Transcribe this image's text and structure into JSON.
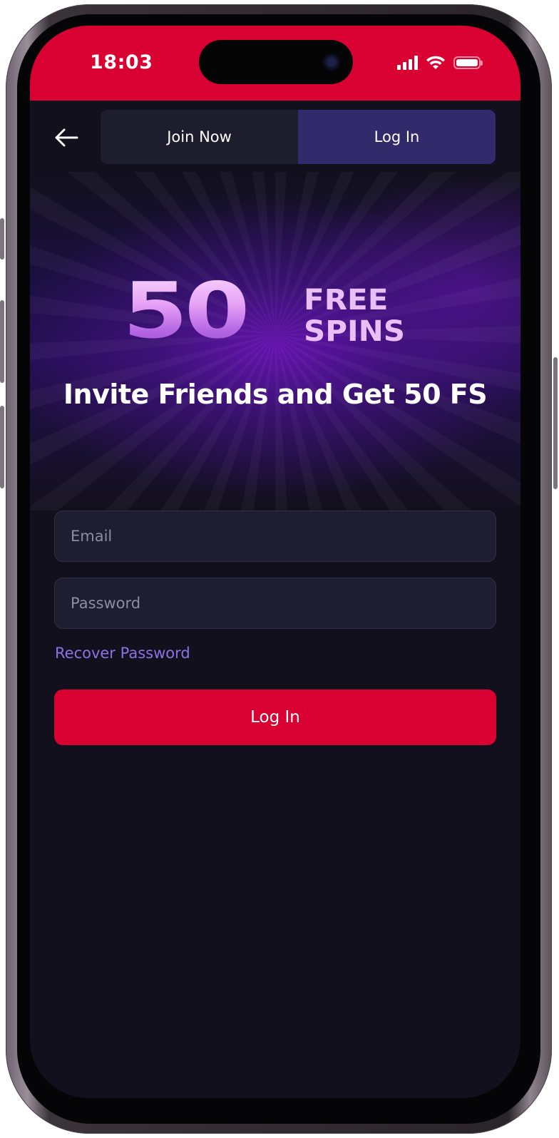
{
  "status_bar": {
    "time": "18:03",
    "background_color": "#d90032",
    "icons": [
      "signal-icon",
      "wifi-icon",
      "battery-icon"
    ]
  },
  "nav": {
    "back_icon": "arrow-left-icon",
    "tabs": [
      {
        "label": "Join Now",
        "active": false
      },
      {
        "label": "Log In",
        "active": true
      }
    ]
  },
  "banner": {
    "promo_number": "50",
    "promo_word_1": "FREE",
    "promo_word_2": "SPINS",
    "subtitle": "Invite Friends and Get 50 FS"
  },
  "form": {
    "email_placeholder": "Email",
    "email_value": "",
    "password_placeholder": "Password",
    "password_value": "",
    "recover_link": "Recover Password",
    "submit_label": "Log In"
  },
  "colors": {
    "accent": "#d90032",
    "background": "#12101d",
    "active_tab": "#312b6b",
    "link": "#8d72e6",
    "promo": "#e7a3f6"
  }
}
